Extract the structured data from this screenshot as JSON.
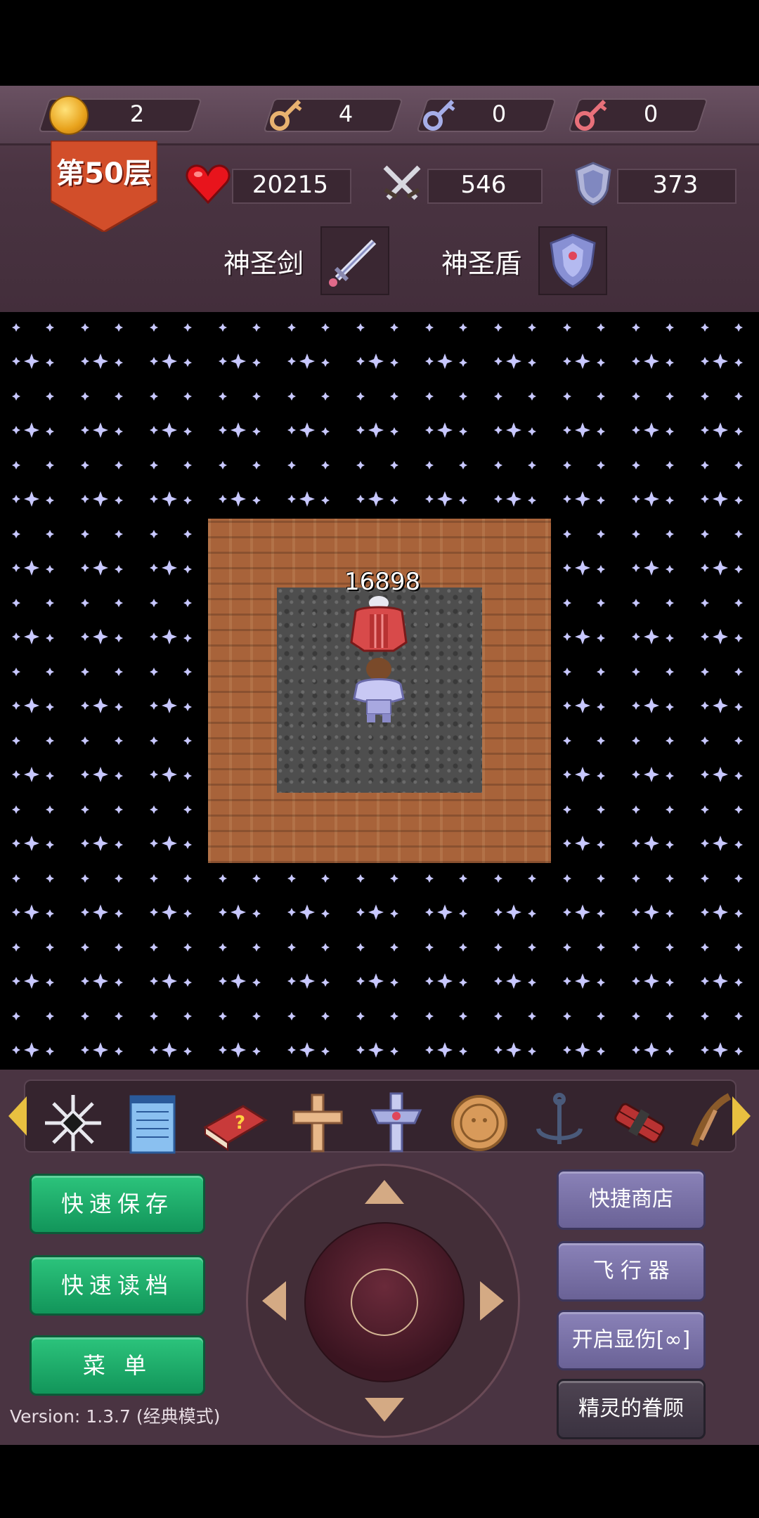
{
  "resources": {
    "gold": "2",
    "yellow_keys": "4",
    "blue_keys": "0",
    "red_keys": "0"
  },
  "floor": {
    "label": "第50层"
  },
  "stats": {
    "hp": "20215",
    "attack": "546",
    "defense": "373"
  },
  "equipment": {
    "weapon_label": "神圣剑",
    "shield_label": "神圣盾"
  },
  "board": {
    "damage_preview": "16898"
  },
  "items": [
    {
      "icon": "snowflake-cross-icon"
    },
    {
      "icon": "notepad-icon"
    },
    {
      "icon": "red-book-icon"
    },
    {
      "icon": "holy-cross-icon"
    },
    {
      "icon": "crystal-cross-icon"
    },
    {
      "icon": "gold-coin-face-icon"
    },
    {
      "icon": "anchor-icon"
    },
    {
      "icon": "dynamite-icon"
    },
    {
      "icon": "pickaxe-icon"
    }
  ],
  "buttons": {
    "quick_save": "快速保存",
    "quick_load": "快速读档",
    "menu": "菜 单",
    "quick_shop": "快捷商店",
    "flyer": "飞 行 器",
    "show_damage": "开启显伤[∞]",
    "fairy_blessing": "精灵的眷顾"
  },
  "version": "Version: 1.3.7 (经典模式)",
  "colors": {
    "hud_bg": "#4a3442",
    "green_button": "#12955a",
    "purple_button": "#6a6296",
    "room_wall": "#a8633a",
    "star": "#c8c8ff"
  }
}
